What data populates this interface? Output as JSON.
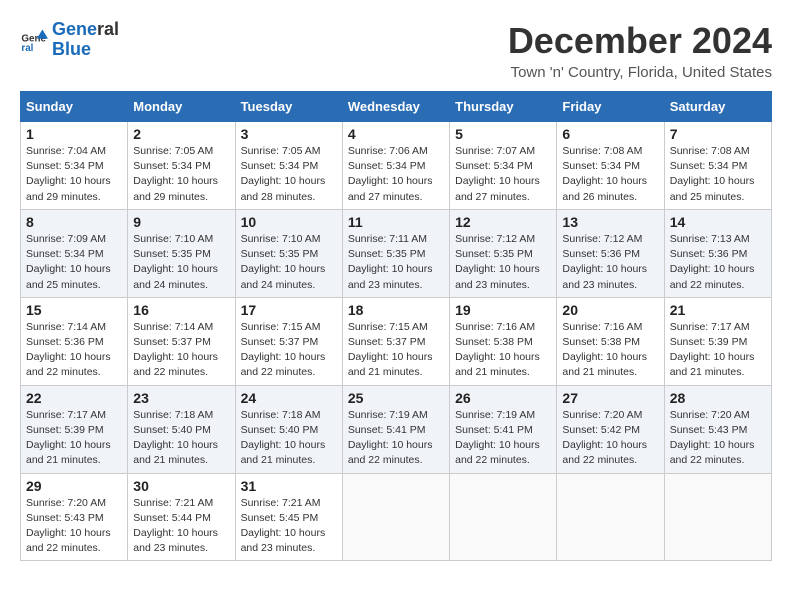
{
  "logo": {
    "line1": "General",
    "line2": "Blue"
  },
  "title": "December 2024",
  "location": "Town 'n' Country, Florida, United States",
  "days_of_week": [
    "Sunday",
    "Monday",
    "Tuesday",
    "Wednesday",
    "Thursday",
    "Friday",
    "Saturday"
  ],
  "weeks": [
    [
      {
        "day": "1",
        "sunrise": "7:04 AM",
        "sunset": "5:34 PM",
        "daylight": "10 hours and 29 minutes."
      },
      {
        "day": "2",
        "sunrise": "7:05 AM",
        "sunset": "5:34 PM",
        "daylight": "10 hours and 29 minutes."
      },
      {
        "day": "3",
        "sunrise": "7:05 AM",
        "sunset": "5:34 PM",
        "daylight": "10 hours and 28 minutes."
      },
      {
        "day": "4",
        "sunrise": "7:06 AM",
        "sunset": "5:34 PM",
        "daylight": "10 hours and 27 minutes."
      },
      {
        "day": "5",
        "sunrise": "7:07 AM",
        "sunset": "5:34 PM",
        "daylight": "10 hours and 27 minutes."
      },
      {
        "day": "6",
        "sunrise": "7:08 AM",
        "sunset": "5:34 PM",
        "daylight": "10 hours and 26 minutes."
      },
      {
        "day": "7",
        "sunrise": "7:08 AM",
        "sunset": "5:34 PM",
        "daylight": "10 hours and 25 minutes."
      }
    ],
    [
      {
        "day": "8",
        "sunrise": "7:09 AM",
        "sunset": "5:34 PM",
        "daylight": "10 hours and 25 minutes."
      },
      {
        "day": "9",
        "sunrise": "7:10 AM",
        "sunset": "5:35 PM",
        "daylight": "10 hours and 24 minutes."
      },
      {
        "day": "10",
        "sunrise": "7:10 AM",
        "sunset": "5:35 PM",
        "daylight": "10 hours and 24 minutes."
      },
      {
        "day": "11",
        "sunrise": "7:11 AM",
        "sunset": "5:35 PM",
        "daylight": "10 hours and 23 minutes."
      },
      {
        "day": "12",
        "sunrise": "7:12 AM",
        "sunset": "5:35 PM",
        "daylight": "10 hours and 23 minutes."
      },
      {
        "day": "13",
        "sunrise": "7:12 AM",
        "sunset": "5:36 PM",
        "daylight": "10 hours and 23 minutes."
      },
      {
        "day": "14",
        "sunrise": "7:13 AM",
        "sunset": "5:36 PM",
        "daylight": "10 hours and 22 minutes."
      }
    ],
    [
      {
        "day": "15",
        "sunrise": "7:14 AM",
        "sunset": "5:36 PM",
        "daylight": "10 hours and 22 minutes."
      },
      {
        "day": "16",
        "sunrise": "7:14 AM",
        "sunset": "5:37 PM",
        "daylight": "10 hours and 22 minutes."
      },
      {
        "day": "17",
        "sunrise": "7:15 AM",
        "sunset": "5:37 PM",
        "daylight": "10 hours and 22 minutes."
      },
      {
        "day": "18",
        "sunrise": "7:15 AM",
        "sunset": "5:37 PM",
        "daylight": "10 hours and 21 minutes."
      },
      {
        "day": "19",
        "sunrise": "7:16 AM",
        "sunset": "5:38 PM",
        "daylight": "10 hours and 21 minutes."
      },
      {
        "day": "20",
        "sunrise": "7:16 AM",
        "sunset": "5:38 PM",
        "daylight": "10 hours and 21 minutes."
      },
      {
        "day": "21",
        "sunrise": "7:17 AM",
        "sunset": "5:39 PM",
        "daylight": "10 hours and 21 minutes."
      }
    ],
    [
      {
        "day": "22",
        "sunrise": "7:17 AM",
        "sunset": "5:39 PM",
        "daylight": "10 hours and 21 minutes."
      },
      {
        "day": "23",
        "sunrise": "7:18 AM",
        "sunset": "5:40 PM",
        "daylight": "10 hours and 21 minutes."
      },
      {
        "day": "24",
        "sunrise": "7:18 AM",
        "sunset": "5:40 PM",
        "daylight": "10 hours and 21 minutes."
      },
      {
        "day": "25",
        "sunrise": "7:19 AM",
        "sunset": "5:41 PM",
        "daylight": "10 hours and 22 minutes."
      },
      {
        "day": "26",
        "sunrise": "7:19 AM",
        "sunset": "5:41 PM",
        "daylight": "10 hours and 22 minutes."
      },
      {
        "day": "27",
        "sunrise": "7:20 AM",
        "sunset": "5:42 PM",
        "daylight": "10 hours and 22 minutes."
      },
      {
        "day": "28",
        "sunrise": "7:20 AM",
        "sunset": "5:43 PM",
        "daylight": "10 hours and 22 minutes."
      }
    ],
    [
      {
        "day": "29",
        "sunrise": "7:20 AM",
        "sunset": "5:43 PM",
        "daylight": "10 hours and 22 minutes."
      },
      {
        "day": "30",
        "sunrise": "7:21 AM",
        "sunset": "5:44 PM",
        "daylight": "10 hours and 23 minutes."
      },
      {
        "day": "31",
        "sunrise": "7:21 AM",
        "sunset": "5:45 PM",
        "daylight": "10 hours and 23 minutes."
      },
      null,
      null,
      null,
      null
    ]
  ]
}
